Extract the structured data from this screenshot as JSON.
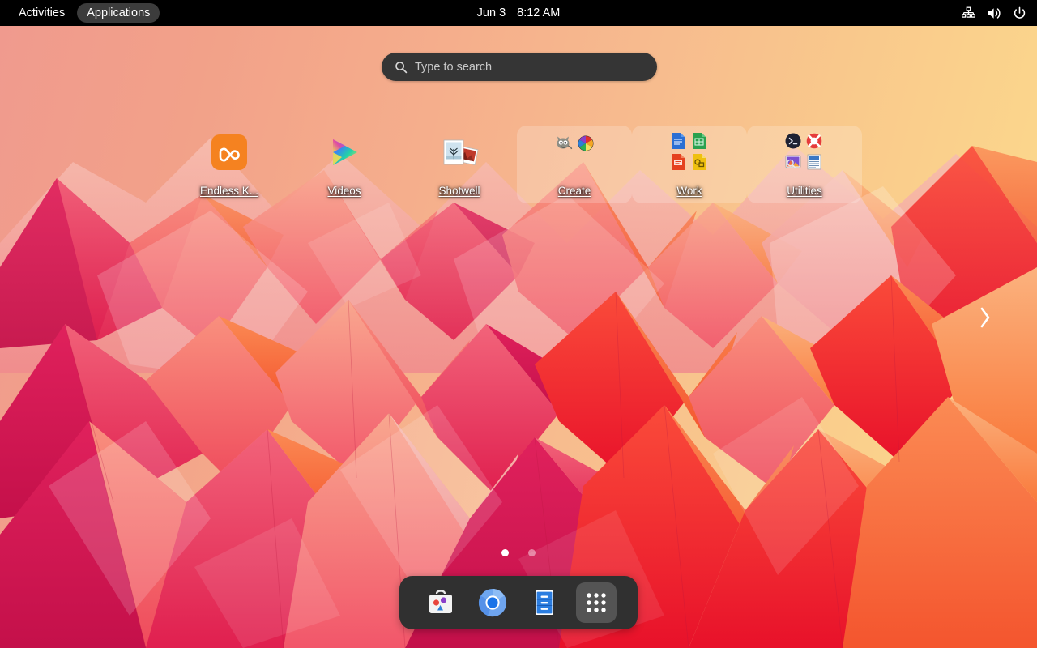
{
  "topbar": {
    "activities_label": "Activities",
    "applications_label": "Applications",
    "date": "Jun 3",
    "time": "8:12 AM",
    "status_icons": [
      {
        "name": "network-wired-icon",
        "glyph": "network"
      },
      {
        "name": "volume-icon",
        "glyph": "speaker"
      },
      {
        "name": "power-icon",
        "glyph": "power"
      }
    ]
  },
  "search": {
    "placeholder": "Type to search",
    "value": "",
    "icon": "search-icon"
  },
  "desktop": {
    "items": [
      {
        "label": "Endless K...",
        "type": "app",
        "icon": "endless-key-icon"
      },
      {
        "label": "Videos",
        "type": "app",
        "icon": "videos-icon"
      },
      {
        "label": "Shotwell",
        "type": "app",
        "icon": "shotwell-icon"
      },
      {
        "label": "Create",
        "type": "folder",
        "icon": "create-folder-icon"
      },
      {
        "label": "Work",
        "type": "folder",
        "icon": "work-folder-icon"
      },
      {
        "label": "Utilities",
        "type": "folder",
        "icon": "utilities-folder-icon"
      }
    ],
    "pages": {
      "count": 2,
      "active": 1
    },
    "next_page_icon": "chevron-right-icon"
  },
  "dock": {
    "items": [
      {
        "name": "app-center",
        "icon": "app-center-icon",
        "active": false
      },
      {
        "name": "chromium",
        "icon": "chromium-icon",
        "active": false
      },
      {
        "name": "files",
        "icon": "files-icon",
        "active": false
      },
      {
        "name": "show-apps",
        "icon": "app-grid-icon",
        "active": true
      }
    ]
  },
  "colors": {
    "topbar_bg": "#000000",
    "search_bg": "#353535",
    "dock_bg": "#303030",
    "dock_highlight": "#545454",
    "accent_orange": "#f58220",
    "wallpaper_left": "#f09a8e",
    "wallpaper_right": "#fcdd94"
  }
}
